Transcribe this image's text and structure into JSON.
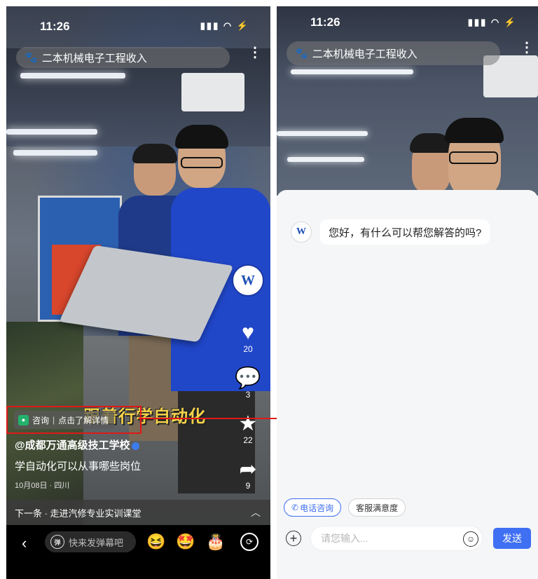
{
  "left": {
    "status": {
      "time": "11:26",
      "signal": "▮▮▮ ◠ ⚡"
    },
    "search": {
      "icon": "paw-icon",
      "query": "二本机械电子工程收入"
    },
    "more_label": "⋮",
    "side_actions": {
      "brand_label": "W",
      "like": {
        "icon": "heart-icon",
        "count": "20"
      },
      "comment": {
        "icon": "comment-icon",
        "count": "3"
      },
      "favorite": {
        "icon": "star-icon",
        "count": "22"
      },
      "share": {
        "icon": "share-icon",
        "count": "9"
      }
    },
    "overlay_title": "跟着行学自动化",
    "consult_chip": {
      "label": "咨询",
      "separator": "|",
      "action": "点击了解详情"
    },
    "author": "@成都万通高级技工学校",
    "description": "学自动化可以从事哪些岗位",
    "meta": "10月08日 · 四川",
    "next_up": "下一条 · 走进汽修专业实训课堂",
    "bottom": {
      "back": "‹",
      "danmu_badge": "弹",
      "danmu_placeholder": "快来发弹幕吧",
      "emojis": [
        "😆",
        "🤩",
        "🎂"
      ],
      "rotate": "⟳"
    }
  },
  "right": {
    "status": {
      "time": "11:26",
      "signal": "▮▮▮ ◠ ⚡"
    },
    "search": {
      "icon": "paw-icon",
      "query": "二本机械电子工程收入"
    },
    "more_label": "⋮",
    "bot_avatar_label": "W",
    "greeting": "您好，有什么可以帮您解答的吗?",
    "quick_replies": {
      "phone": "电话咨询",
      "phone_icon": "✆",
      "satisfaction": "客服满意度"
    },
    "input": {
      "placeholder": "请您输入...",
      "send": "发送",
      "plus": "+",
      "emoji": "☺"
    }
  },
  "colors": {
    "accent": "#3f6ff2",
    "highlight_box": "#e01818",
    "chip_green": "#23b26d"
  }
}
